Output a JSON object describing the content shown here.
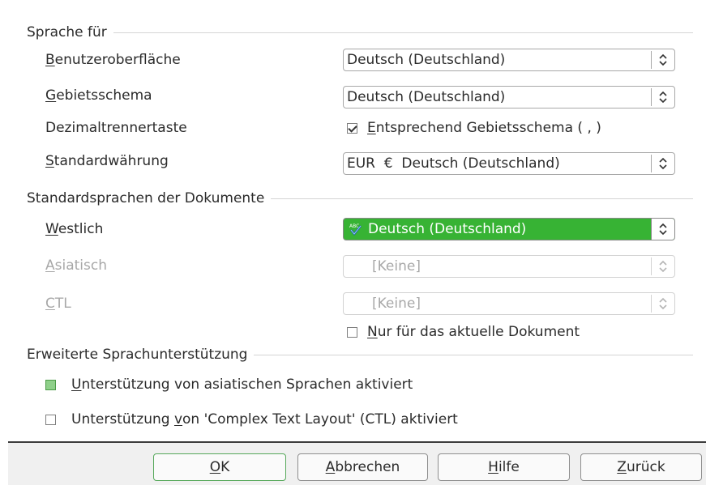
{
  "sections": {
    "sprache_fuer": "Sprache für",
    "standardsprachen": "Standardsprachen der Dokumente",
    "erweiterte": "Erweiterte Sprachunterstützung"
  },
  "rows": {
    "benutzeroberflaeche": {
      "label_first": "B",
      "label_rest": "enutzeroberfläche",
      "value": "Deutsch (Deutschland)"
    },
    "gebietsschema": {
      "label_first": "G",
      "label_rest": "ebietsschema",
      "value": "Deutsch (Deutschland)"
    },
    "dezimaltrenner": {
      "label": "Dezimaltrennertaste",
      "check_first": "E",
      "check_rest": "ntsprechend Gebietsschema ( , )",
      "checked": true
    },
    "standardwaehrung": {
      "label_first": "S",
      "label_rest": "tandardwährung",
      "value": "EUR  €  Deutsch (Deutschland)"
    },
    "westlich": {
      "label_first": "W",
      "label_rest": "estlich",
      "value": "Deutsch (Deutschland)"
    },
    "asiatisch": {
      "label_first": "A",
      "label_rest": "siatisch",
      "value": "[Keine]"
    },
    "ctl": {
      "label_first": "C",
      "label_rest": "TL",
      "value": "[Keine]"
    }
  },
  "checks": {
    "nur_aktuelles": {
      "first": "N",
      "rest": "ur für das aktuelle Dokument",
      "checked": false
    },
    "asiatisch": {
      "first": "U",
      "rest": "nterstützung von asiatischen Sprachen aktiviert",
      "checked": false
    },
    "ctl": {
      "before": "Unterstützung ",
      "mnemonic": "v",
      "after": "on 'Complex Text Layout' (CTL) aktiviert",
      "checked": false
    }
  },
  "buttons": {
    "ok": {
      "first": "O",
      "rest": "K"
    },
    "abbrechen": {
      "first": "A",
      "rest": "bbrechen"
    },
    "hilfe": {
      "first": "H",
      "rest": "ilfe"
    },
    "zurueck": {
      "first": "Z",
      "rest": "urück"
    }
  },
  "icons": {
    "spell_check": "spellcheck-abc-icon",
    "spin": "spin-updown-icon"
  },
  "colors": {
    "highlight": "#37b334",
    "focus_checkbox": "#8fd08a",
    "disabled_text": "#a8a8a8"
  }
}
